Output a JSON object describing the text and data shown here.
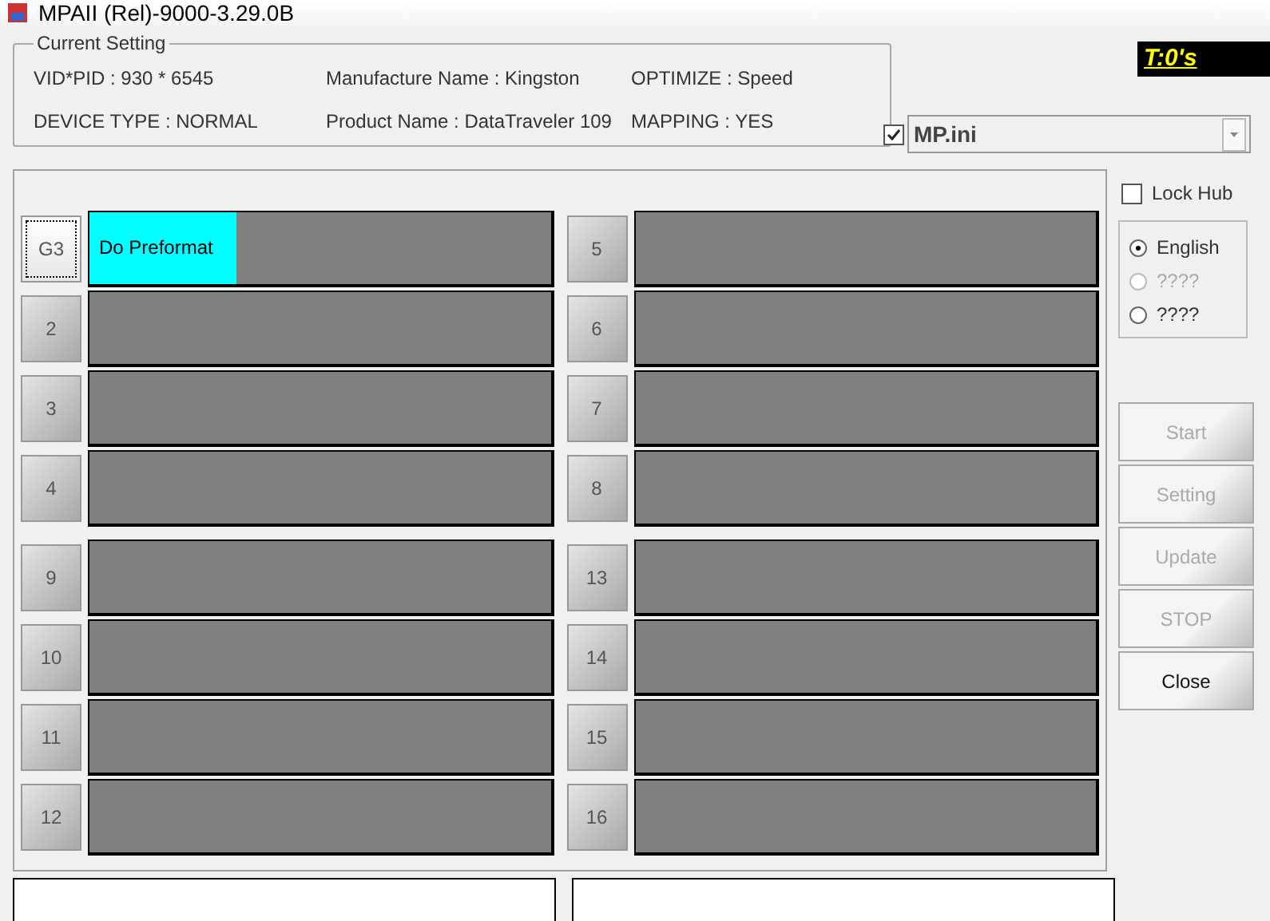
{
  "window": {
    "title": "MPAII (Rel)-9000-3.29.0B"
  },
  "current_setting": {
    "title": "Current Setting",
    "fields": [
      {
        "label": "VID*PID :  930 * 6545"
      },
      {
        "label": "Manufacture Name : Kingston"
      },
      {
        "label": "OPTIMIZE : Speed"
      },
      {
        "label": "DEVICE TYPE : NORMAL"
      },
      {
        "label": "Product Name : DataTraveler 109"
      },
      {
        "label": "MAPPING : YES"
      }
    ]
  },
  "timer": "T:0's",
  "ini": {
    "checked": true,
    "value": "MP.ini"
  },
  "lock_hub": {
    "label": "Lock Hub",
    "checked": false
  },
  "languages": [
    {
      "label": "English",
      "selected": true,
      "disabled": false
    },
    {
      "label": "????",
      "selected": false,
      "disabled": true
    },
    {
      "label": "????",
      "selected": false,
      "disabled": false
    }
  ],
  "port_groups": [
    {
      "left": [
        {
          "label": "G3",
          "level": 0.32,
          "status": "Do Preformat",
          "focused": true
        },
        {
          "label": "2",
          "focused": false
        },
        {
          "label": "3",
          "focused": false
        },
        {
          "label": "4",
          "focused": false
        }
      ],
      "right": [
        {
          "label": "5",
          "focused": false
        },
        {
          "label": "6",
          "focused": false
        },
        {
          "label": "7",
          "focused": false
        },
        {
          "label": "8",
          "focused": false
        }
      ]
    },
    {
      "left": [
        {
          "label": "9",
          "focused": false
        },
        {
          "label": "10",
          "focused": false
        },
        {
          "label": "11",
          "focused": false
        },
        {
          "label": "12",
          "focused": false
        }
      ],
      "right": [
        {
          "label": "13",
          "focused": false
        },
        {
          "label": "14",
          "focused": false
        },
        {
          "label": "15",
          "focused": false
        },
        {
          "label": "16",
          "focused": false
        }
      ]
    }
  ],
  "actions": [
    {
      "label": "Start",
      "disabled": true
    },
    {
      "label": "Setting",
      "disabled": true
    },
    {
      "label": "Update",
      "disabled": true
    },
    {
      "label": "STOP",
      "disabled": true
    },
    {
      "label": "Close",
      "disabled": false
    }
  ]
}
